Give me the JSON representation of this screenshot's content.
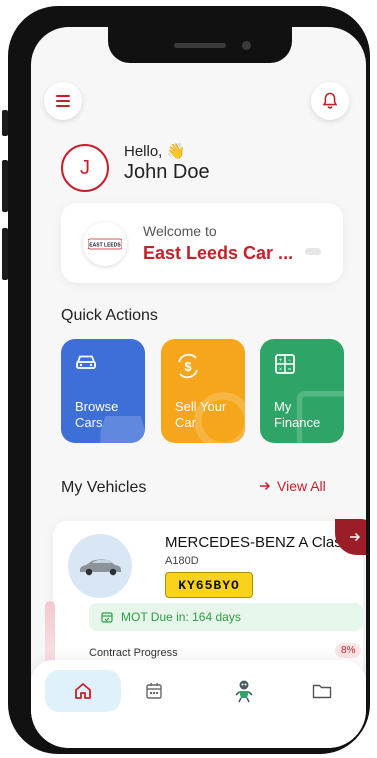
{
  "header": {
    "menu_icon": "hamburger-menu-icon",
    "bell_icon": "bell-icon"
  },
  "greeting": {
    "avatar_initial": "J",
    "hello": "Hello, 👋",
    "name": "John Doe"
  },
  "welcome": {
    "logo_text": "EAST LEEDS",
    "subtitle": "Welcome to",
    "title": "East Leeds Car ..."
  },
  "quick_actions": {
    "title": "Quick Actions",
    "items": [
      {
        "label_line1": "Browse",
        "label_line2": "Cars",
        "icon": "car-icon",
        "color": "#3d6fd6"
      },
      {
        "label_line1": "Sell Your",
        "label_line2": "Car",
        "icon": "dollar-sign-icon",
        "color": "#f6a61a"
      },
      {
        "label_line1": "My",
        "label_line2": "Finance",
        "icon": "calculator-icon",
        "color": "#2ea566"
      }
    ]
  },
  "vehicles": {
    "title": "My Vehicles",
    "view_all": "View All",
    "card": {
      "name": "MERCEDES-BENZ A Class",
      "model": "A180D",
      "plate": "KY65BYO",
      "mot": "MOT Due in: 164 days",
      "contract_label": "Contract Progress",
      "contract_percent": "8%"
    }
  },
  "bottom_nav": {
    "items": [
      {
        "icon": "home-icon",
        "active": true
      },
      {
        "icon": "calendar-icon",
        "active": false
      },
      {
        "icon": "mascot-icon",
        "active": false
      },
      {
        "icon": "folder-icon",
        "active": false
      }
    ]
  },
  "colors": {
    "brand_red": "#c8202b",
    "browse_blue": "#3d6fd6",
    "sell_orange": "#f6a61a",
    "finance_green": "#2ea566",
    "mot_green": "#2f9b46",
    "plate_yellow": "#f8d21b"
  }
}
